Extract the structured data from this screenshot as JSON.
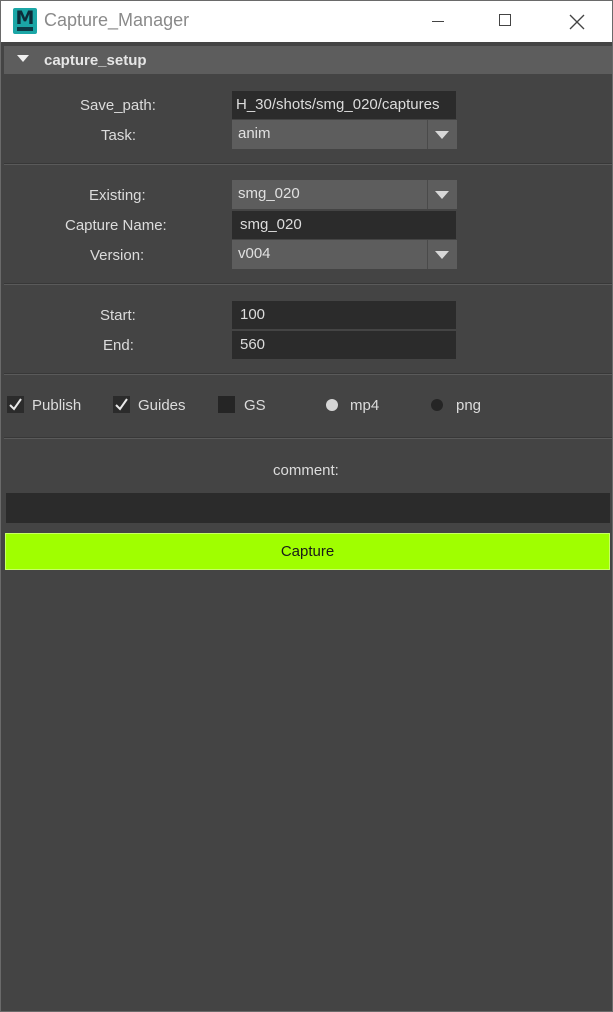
{
  "window": {
    "title": "Capture_Manager",
    "app_icon_letter": "M",
    "accent": "#a0ff00"
  },
  "section": {
    "title": "capture_setup"
  },
  "paths": {
    "save_path_label": "Save_path:",
    "save_path_value": "H_30/shots/smg_020/captures",
    "task_label": "Task:",
    "task_value": "anim"
  },
  "capture": {
    "existing_label": "Existing:",
    "existing_value": "smg_020",
    "name_label": "Capture Name:",
    "name_value": "smg_020",
    "version_label": "Version:",
    "version_value": "v004"
  },
  "frames": {
    "start_label": "Start:",
    "start_value": "100",
    "end_label": "End:",
    "end_value": "560"
  },
  "options": {
    "publish_label": "Publish",
    "publish_checked": true,
    "guides_label": "Guides",
    "guides_checked": true,
    "gs_label": "GS",
    "gs_checked": false,
    "mp4_label": "mp4",
    "mp4_selected": true,
    "png_label": "png",
    "png_selected": false
  },
  "comment": {
    "label": "comment:",
    "value": ""
  },
  "actions": {
    "capture_label": "Capture"
  }
}
